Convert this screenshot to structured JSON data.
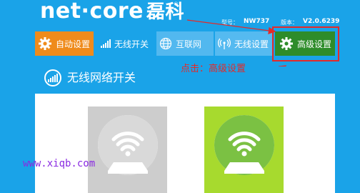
{
  "header": {
    "logo_text": "net·core",
    "logo_cn": "磊科",
    "registered": "®",
    "model_label": "型号：",
    "model_value": "NW737",
    "version_label": "版本：",
    "version_value": "V2.0.6239"
  },
  "tabs": [
    {
      "label": "自动设置",
      "icon": "gear-icon"
    },
    {
      "label": "无线开关",
      "icon": "signal-bars-icon"
    },
    {
      "label": "互联网",
      "icon": "globe-icon"
    },
    {
      "label": "无线设置",
      "icon": "wireless-icon"
    },
    {
      "label": "高级设置",
      "icon": "gear-icon"
    }
  ],
  "annotation": "点击：高级设置",
  "panel": {
    "title": "无线网络开关"
  },
  "watermark": "www.xiqb.com",
  "colors": {
    "header_blue": "#1aa3e8",
    "orange": "#ef8b1b",
    "green": "#2e8c2a",
    "card_on": "#a7da2e",
    "card_off": "#cdcdcd",
    "annotation_red": "#e32a2a"
  }
}
